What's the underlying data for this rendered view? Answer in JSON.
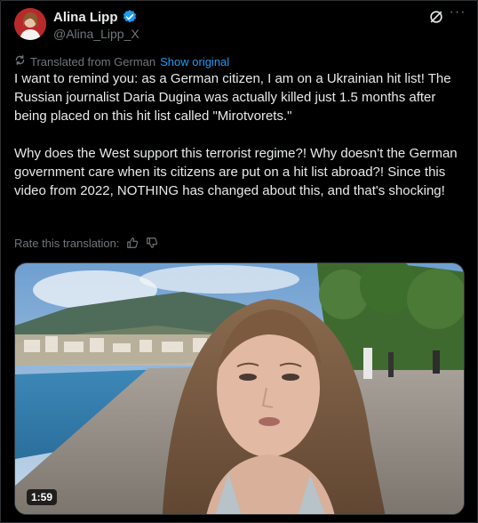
{
  "author": {
    "name": "Alina Lipp",
    "handle": "@Alina_Lipp_X",
    "verified_color": "#1d9bf0"
  },
  "translation": {
    "label": "Translated from German",
    "show_original": "Show original"
  },
  "tweet": {
    "text": "I want to remind you: as a German citizen, I am on a Ukrainian hit list! The Russian journalist Daria Dugina was actually killed just 1.5 months after being placed on this hit list called \"Mirotvorets.\"\n\nWhy does the West support this terrorist regime?! Why doesn't the German government care when its citizens are put on a hit list abroad?! Since this video from 2022, NOTHING has changed about this, and that's shocking!"
  },
  "rating": {
    "label": "Rate this translation:",
    "up_icon": "thumbs-up-icon",
    "down_icon": "thumbs-down-icon"
  },
  "video": {
    "duration": "1:59"
  },
  "colors": {
    "background": "#000000",
    "text": "#e7e9ea",
    "secondary": "#71767b",
    "link": "#1d9bf0",
    "border": "#2f3336"
  }
}
